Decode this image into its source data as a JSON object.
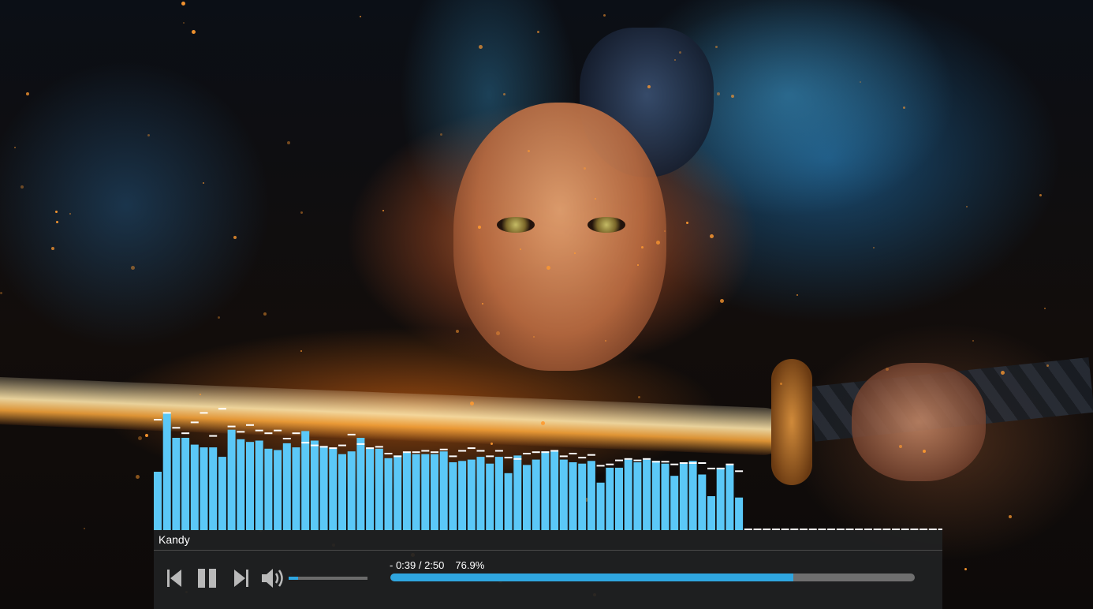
{
  "player": {
    "track_title": "Kandy",
    "time_elapsed_remaining": "- 0:39 / 2:50",
    "progress_percent": "76.9%",
    "progress_fraction": 0.769,
    "volume_fraction": 0.12,
    "controls": {
      "previous_icon": "skip-previous-icon",
      "pause_icon": "pause-icon",
      "next_icon": "skip-next-icon",
      "volume_icon": "volume-icon"
    }
  },
  "visualizer": {
    "bar_color": "#5bc8f7",
    "peak_color": "#ffffff",
    "levels": [
      0.43,
      0.86,
      0.68,
      0.68,
      0.63,
      0.61,
      0.61,
      0.54,
      0.74,
      0.67,
      0.65,
      0.66,
      0.6,
      0.59,
      0.64,
      0.61,
      0.73,
      0.66,
      0.62,
      0.6,
      0.56,
      0.58,
      0.68,
      0.6,
      0.6,
      0.53,
      0.55,
      0.57,
      0.56,
      0.56,
      0.56,
      0.58,
      0.5,
      0.51,
      0.52,
      0.54,
      0.49,
      0.54,
      0.42,
      0.55,
      0.48,
      0.52,
      0.58,
      0.58,
      0.52,
      0.5,
      0.49,
      0.51,
      0.35,
      0.46,
      0.46,
      0.52,
      0.5,
      0.52,
      0.51,
      0.49,
      0.4,
      0.5,
      0.51,
      0.41,
      0.25,
      0.46,
      0.48,
      0.24
    ],
    "peaks": [
      0.82,
      0.87,
      0.76,
      0.72,
      0.8,
      0.87,
      0.7,
      0.9,
      0.77,
      0.73,
      0.78,
      0.74,
      0.72,
      0.74,
      0.68,
      0.72,
      0.65,
      0.63,
      0.62,
      0.61,
      0.63,
      0.71,
      0.64,
      0.61,
      0.62,
      0.57,
      0.55,
      0.58,
      0.58,
      0.59,
      0.58,
      0.6,
      0.55,
      0.59,
      0.61,
      0.59,
      0.55,
      0.59,
      0.54,
      0.53,
      0.57,
      0.58,
      0.58,
      0.59,
      0.55,
      0.57,
      0.54,
      0.56,
      0.48,
      0.49,
      0.52,
      0.53,
      0.52,
      0.53,
      0.51,
      0.51,
      0.49,
      0.5,
      0.5,
      0.5,
      0.46,
      0.46,
      0.49,
      0.44
    ],
    "empty_slots": 22
  }
}
